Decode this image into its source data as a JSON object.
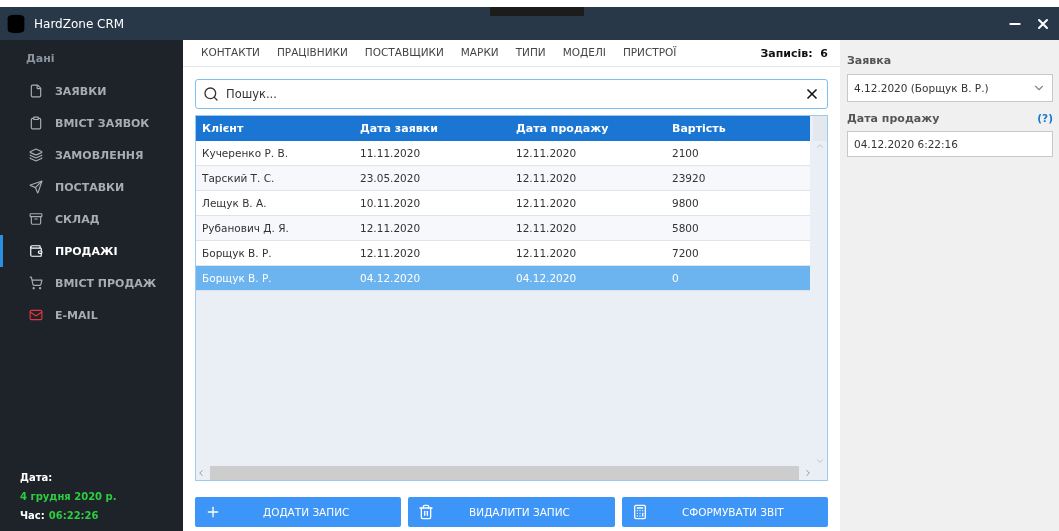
{
  "window": {
    "title": "HardZone CRM"
  },
  "sidebar": {
    "heading": "Дані",
    "items": [
      {
        "label": "ЗАЯВКИ",
        "selected": false
      },
      {
        "label": "ВМІСТ ЗАЯВОК",
        "selected": false
      },
      {
        "label": "ЗАМОВЛЕННЯ",
        "selected": false
      },
      {
        "label": "ПОСТАВКИ",
        "selected": false
      },
      {
        "label": "СКЛАД",
        "selected": false
      },
      {
        "label": "ПРОДАЖІ",
        "selected": true
      },
      {
        "label": "ВМІСТ ПРОДАЖ",
        "selected": false
      },
      {
        "label": "E-MAIL",
        "selected": false
      }
    ],
    "date_label": "Дата:",
    "date": "4 грудня 2020 р.",
    "time_label": "Час:",
    "time": "06:22:26"
  },
  "tabs": [
    {
      "label": "КОНТАКТИ",
      "selected": false
    },
    {
      "label": "ПРАЦІВНИКИ",
      "selected": false
    },
    {
      "label": "ПОСТАВЩИКИ",
      "selected": false
    },
    {
      "label": "МАРКИ",
      "selected": false
    },
    {
      "label": "ТИПИ",
      "selected": false
    },
    {
      "label": "МОДЕЛІ",
      "selected": false
    },
    {
      "label": "ПРИСТРОЇ",
      "selected": false
    }
  ],
  "record_count": {
    "label": "Записів:",
    "value": "6"
  },
  "search": {
    "placeholder": "Пошук..."
  },
  "table": {
    "columns": [
      "Клієнт",
      "Дата заявки",
      "Дата продажу",
      "Вартість"
    ],
    "rows": [
      {
        "cells": [
          "Кучеренко Р. В.",
          "11.11.2020",
          "12.11.2020",
          "2100"
        ],
        "selected": false
      },
      {
        "cells": [
          "Тарский Т. С.",
          "23.05.2020",
          "12.11.2020",
          "23920"
        ],
        "selected": false
      },
      {
        "cells": [
          "Лещук В. А.",
          "10.11.2020",
          "12.11.2020",
          "9800"
        ],
        "selected": false
      },
      {
        "cells": [
          "Рубанович Д. Я.",
          "12.11.2020",
          "12.11.2020",
          "5800"
        ],
        "selected": false
      },
      {
        "cells": [
          "Борщук В. Р.",
          "12.11.2020",
          "12.11.2020",
          "7200"
        ],
        "selected": false
      },
      {
        "cells": [
          "Борщук В. Р.",
          "04.12.2020",
          "04.12.2020",
          "0"
        ],
        "selected": true
      }
    ]
  },
  "buttons": [
    {
      "label": "ДОДАТИ ЗАПИС"
    },
    {
      "label": "ВИДАЛИТИ ЗАПИС"
    },
    {
      "label": "СФОРМУВАТИ ЗВІТ"
    }
  ],
  "form": {
    "request_label": "Заявка",
    "request_value": "4.12.2020 (Борщук В. Р.)",
    "sale_date_label": "Дата продажу",
    "help": "(?)",
    "sale_date_value": "04.12.2020 6:22:16"
  }
}
